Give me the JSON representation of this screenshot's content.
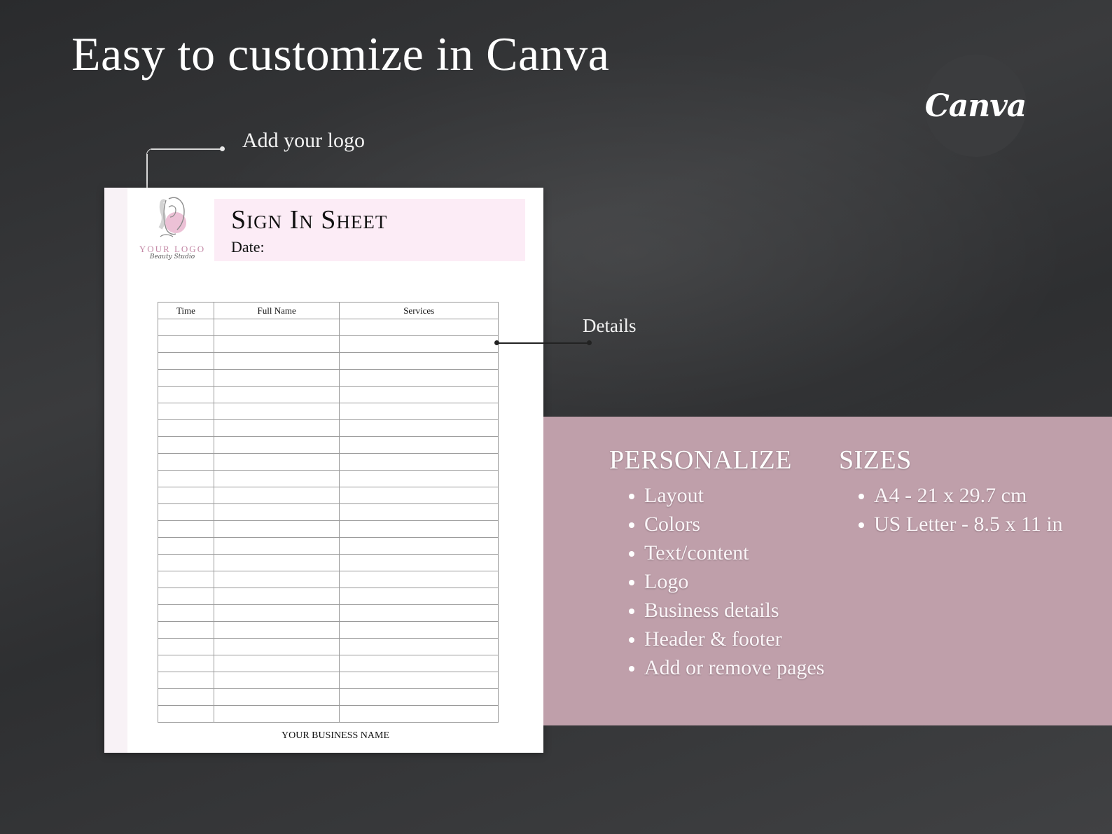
{
  "heading": "Easy to customize in Canva",
  "badge": {
    "label": "Canva"
  },
  "callouts": {
    "logo": "Add your logo",
    "details": "Details"
  },
  "sheet": {
    "logo_text": "YOUR LOGO",
    "logo_sub": "Beauty Studio",
    "title": "Sign In Sheet",
    "date_label": "Date:",
    "columns": [
      "Time",
      "Full Name",
      "Services"
    ],
    "blank_rows": 24,
    "footer": "YOUR BUSINESS NAME"
  },
  "panel": {
    "personalize": {
      "heading": "PERSONALIZE",
      "items": [
        "Layout",
        "Colors",
        "Text/content",
        "Logo",
        "Business details",
        "Header & footer",
        "Add or remove pages"
      ]
    },
    "sizes": {
      "heading": "SIZES",
      "items": [
        "A4 - 21 x 29.7 cm",
        "US Letter - 8.5 x 11 in"
      ]
    }
  },
  "colors": {
    "background": "#2f3032",
    "panel": "#bf9faa",
    "title_box": "#fcecf6",
    "logo_accent": "#c48aa7"
  }
}
